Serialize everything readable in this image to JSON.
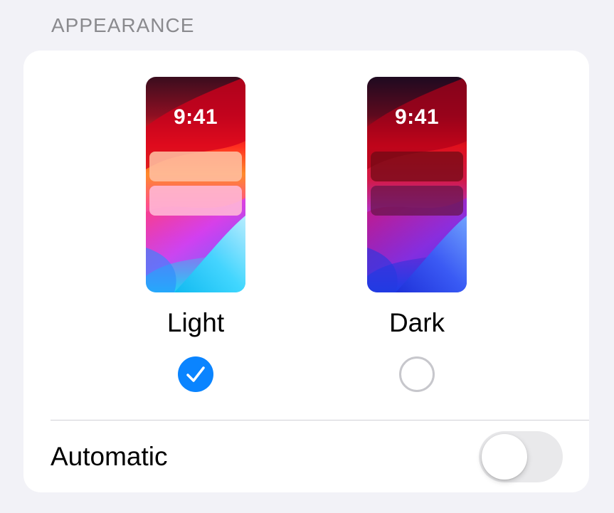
{
  "section": {
    "header": "APPEARANCE"
  },
  "appearance": {
    "options": [
      {
        "label": "Light",
        "clock": "9:41",
        "selected": true,
        "icon": "checkmark-icon"
      },
      {
        "label": "Dark",
        "clock": "9:41",
        "selected": false
      }
    ]
  },
  "automatic": {
    "label": "Automatic",
    "enabled": false
  },
  "colors": {
    "background": "#f2f2f7",
    "card": "#ffffff",
    "accent": "#0a84ff",
    "header_text": "#8a8a8e",
    "toggle_off": "#e9e9eb"
  }
}
